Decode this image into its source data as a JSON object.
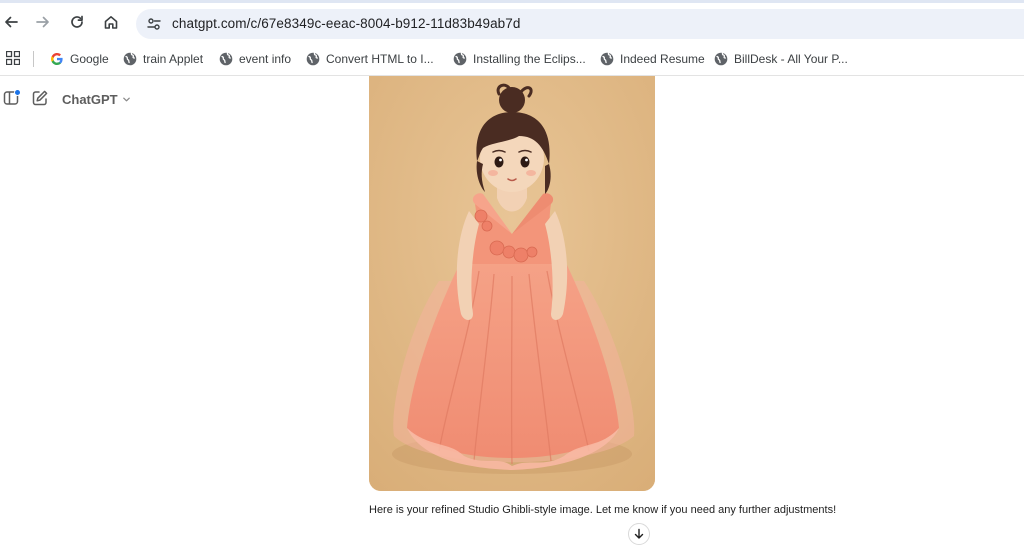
{
  "browser": {
    "url": "chatgpt.com/c/67e8349c-eeac-8004-b912-11d83b49ab7d",
    "bookmarks": [
      {
        "label": "Google",
        "icon": "google-icon"
      },
      {
        "label": "train Applet",
        "icon": "globe-icon"
      },
      {
        "label": "event info",
        "icon": "globe-icon"
      },
      {
        "label": "Convert HTML to I...",
        "icon": "globe-icon"
      },
      {
        "label": "Installing the Eclips...",
        "icon": "globe-icon"
      },
      {
        "label": "Indeed Resume",
        "icon": "globe-icon"
      },
      {
        "label": "BillDesk - All Your P...",
        "icon": "globe-icon"
      }
    ]
  },
  "app": {
    "model_label": "ChatGPT",
    "message_text": "Here is your refined Studio Ghibli-style image. Let me know if you need any further adjustments!"
  },
  "colors": {
    "image_background": "#e3bd8c",
    "dress": "#f2977c",
    "hair": "#4a2c22",
    "omnibox": "#edf1f9",
    "badge_blue": "#1a73e8"
  }
}
